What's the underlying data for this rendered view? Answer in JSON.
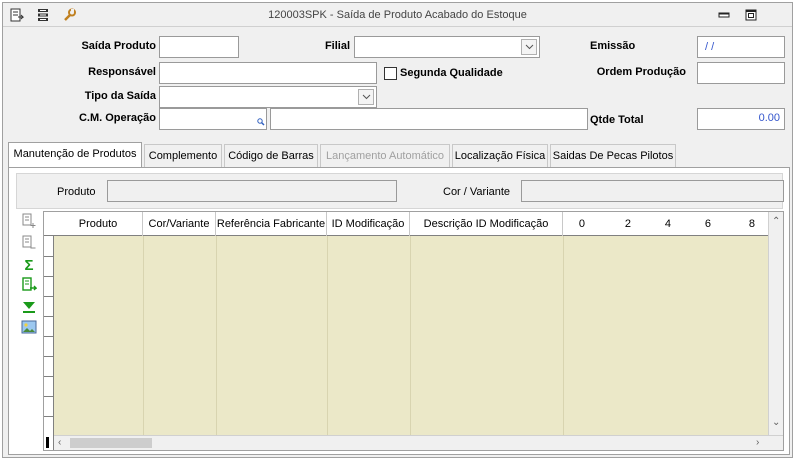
{
  "window": {
    "title": "120003SPK - Saída de Produto Acabado do Estoque",
    "toolbar_icons": [
      "export-icon",
      "stack-icon",
      "wrench-icon"
    ]
  },
  "form": {
    "saida_produto": {
      "label": "Saída Produto",
      "value": ""
    },
    "filial": {
      "label": "Filial",
      "value": ""
    },
    "emissao": {
      "label": "Emissão",
      "value": " / /"
    },
    "responsavel": {
      "label": "Responsável",
      "value": ""
    },
    "segunda_qualidade": {
      "label": "Segunda Qualidade",
      "checked": false
    },
    "ordem_producao": {
      "label": "Ordem Produção",
      "value": ""
    },
    "tipo_saida": {
      "label": "Tipo da Saída",
      "value": ""
    },
    "cm_operacao": {
      "label": "C.M. Operação",
      "code": "",
      "description": ""
    },
    "qtde_total": {
      "label": "Qtde Total",
      "value": "0.00"
    }
  },
  "tabs": [
    {
      "label": "Manutenção de Produtos",
      "active": true,
      "enabled": true
    },
    {
      "label": "Complemento",
      "active": false,
      "enabled": true
    },
    {
      "label": "Código de Barras",
      "active": false,
      "enabled": true
    },
    {
      "label": "Lançamento Automático",
      "active": false,
      "enabled": false
    },
    {
      "label": "Localização Física",
      "active": false,
      "enabled": true
    },
    {
      "label": "Saidas De Pecas Pilotos",
      "active": false,
      "enabled": true
    }
  ],
  "filter": {
    "produto": {
      "label": "Produto",
      "value": ""
    },
    "cor_variante": {
      "label": "Cor / Variante",
      "value": ""
    }
  },
  "side_actions": [
    "add-row-icon",
    "remove-row-icon",
    "sum-icon",
    "export-grid-icon",
    "filter-down-icon",
    "image-icon"
  ],
  "grid": {
    "columns": [
      "Produto",
      "Cor/Variante",
      "Referência Fabricante",
      "ID Modificação",
      "Descrição ID Modificação",
      "0",
      "2",
      "4",
      "6",
      "8"
    ],
    "rows": []
  },
  "colors": {
    "grid_background": "#ebe8c8",
    "emissao_text": "#3355cc",
    "sum_green": "#1a9a1a"
  }
}
